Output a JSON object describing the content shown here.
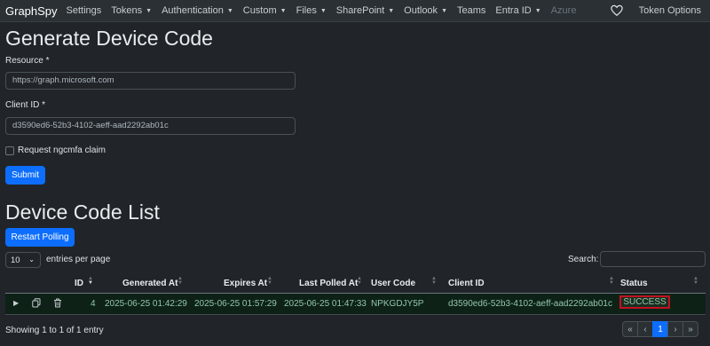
{
  "navbar": {
    "brand": "GraphSpy",
    "items": [
      {
        "label": "Settings",
        "dropdown": false
      },
      {
        "label": "Tokens",
        "dropdown": true
      },
      {
        "label": "Authentication",
        "dropdown": true
      },
      {
        "label": "Custom",
        "dropdown": true
      },
      {
        "label": "Files",
        "dropdown": true
      },
      {
        "label": "SharePoint",
        "dropdown": true
      },
      {
        "label": "Outlook",
        "dropdown": true
      },
      {
        "label": "Teams",
        "dropdown": false
      },
      {
        "label": "Entra ID",
        "dropdown": true
      },
      {
        "label": "Azure",
        "dropdown": false,
        "disabled": true
      }
    ],
    "token_options": "Token Options",
    "heart_icon": "heart-icon"
  },
  "form": {
    "title": "Generate Device Code",
    "resource_label": "Resource *",
    "resource_value": "https://graph.microsoft.com",
    "client_id_label": "Client ID *",
    "client_id_value": "d3590ed6-52b3-4102-aeff-aad2292ab01c",
    "ngcmfa_label": "Request ngcmfa claim",
    "submit_label": "Submit"
  },
  "list": {
    "title": "Device Code List",
    "restart_label": "Restart Polling",
    "page_size": "10",
    "entries_per_page": "entries per page",
    "search_label": "Search:",
    "columns": [
      "ID",
      "Generated At",
      "Expires At",
      "Last Polled At",
      "User Code",
      "Client ID",
      "Status"
    ],
    "rows": [
      {
        "id": "4",
        "generated_at": "2025-06-25 01:42:29",
        "expires_at": "2025-06-25 01:57:29",
        "last_polled_at": "2025-06-25 01:47:33",
        "user_code": "NPKGDJY5P",
        "client_id": "d3590ed6-52b3-4102-aeff-aad2292ab01c",
        "status": "SUCCESS"
      }
    ],
    "showing": "Showing 1 to 1 of 1 entry",
    "pagination": [
      "«",
      "‹",
      "1",
      "›",
      "»"
    ]
  },
  "colors": {
    "accent": "#0d6efd",
    "success_row": "#0d2117",
    "status_outline": "#c1121f"
  }
}
